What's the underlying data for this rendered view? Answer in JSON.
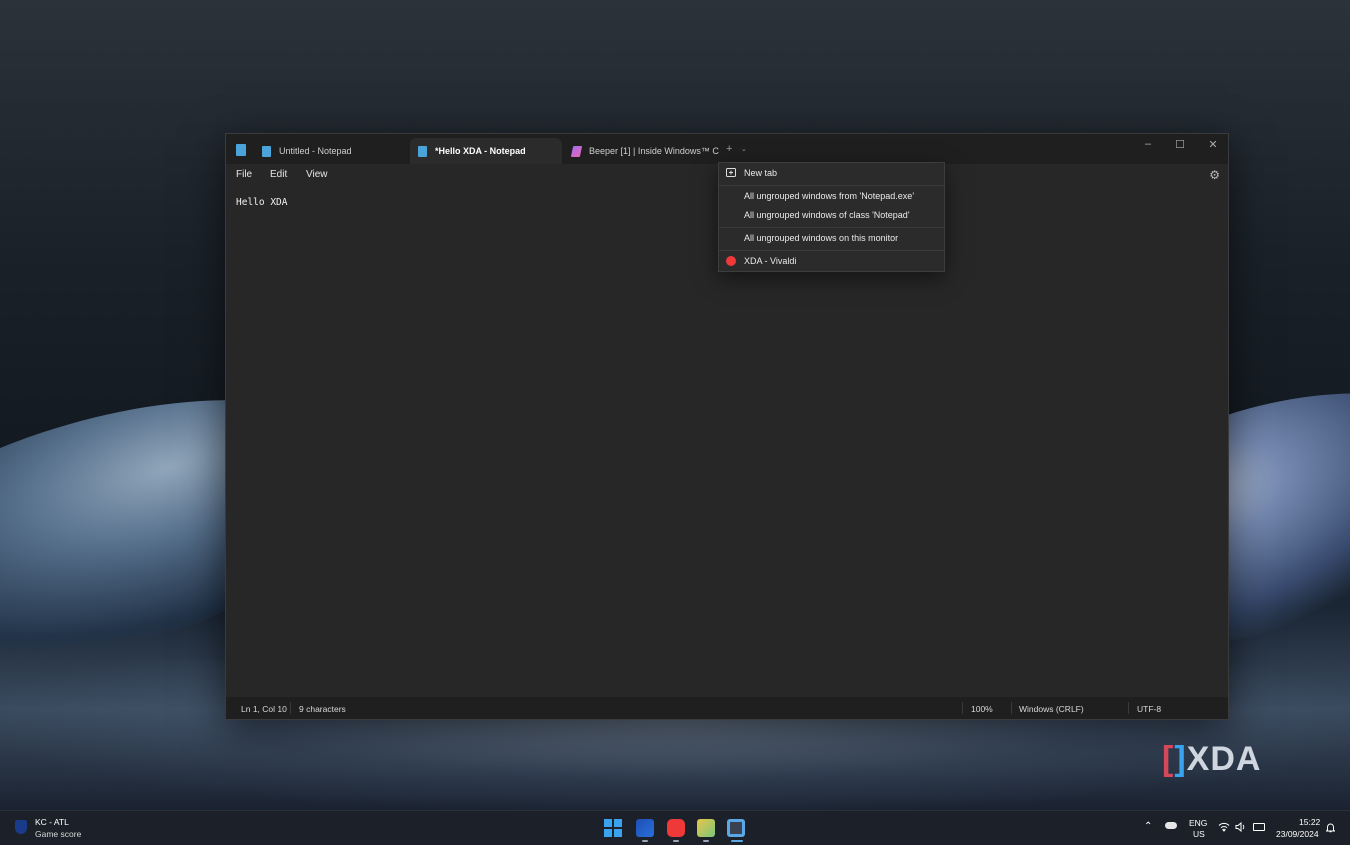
{
  "window": {
    "tabs": [
      {
        "label": "Untitled - Notepad",
        "active": false,
        "icon": "notepad-icon"
      },
      {
        "label": "*Hello XDA - Notepad",
        "active": true,
        "icon": "notepad-icon"
      },
      {
        "label": "Beeper [1] | Inside Windows™ C...",
        "active": false,
        "icon": "beeper-icon"
      }
    ],
    "new_tab_symbol": "+",
    "controls": {
      "minimize": "–",
      "maximize": "☐",
      "close": "✕"
    },
    "menu": {
      "file": "File",
      "edit": "Edit",
      "view": "View"
    },
    "settings_icon": "⚙",
    "editor_text": "Hello XDA",
    "status": {
      "position": "Ln 1, Col 10",
      "characters": "9 characters",
      "zoom": "100%",
      "line_ending": "Windows (CRLF)",
      "encoding": "UTF-8"
    }
  },
  "dropdown": {
    "items": [
      {
        "label": "New tab",
        "icon": "new-tab-icon"
      },
      {
        "label": "All ungrouped windows from 'Notepad.exe'"
      },
      {
        "label": "All ungrouped windows of class 'Notepad'"
      },
      {
        "label": "All ungrouped windows on this monitor"
      },
      {
        "label": "XDA - Vivaldi",
        "icon": "vivaldi-icon"
      }
    ]
  },
  "watermark": {
    "logo": "XDA"
  },
  "taskbar": {
    "widget_title": "KC - ATL",
    "widget_subtitle": "Game score",
    "language_top": "ENG",
    "language_bottom": "US",
    "time": "15:22",
    "date": "23/09/2024"
  },
  "colors": {
    "accent": "#3aa3f0",
    "window_bg": "#272727",
    "vivaldi": "#ef3939"
  }
}
